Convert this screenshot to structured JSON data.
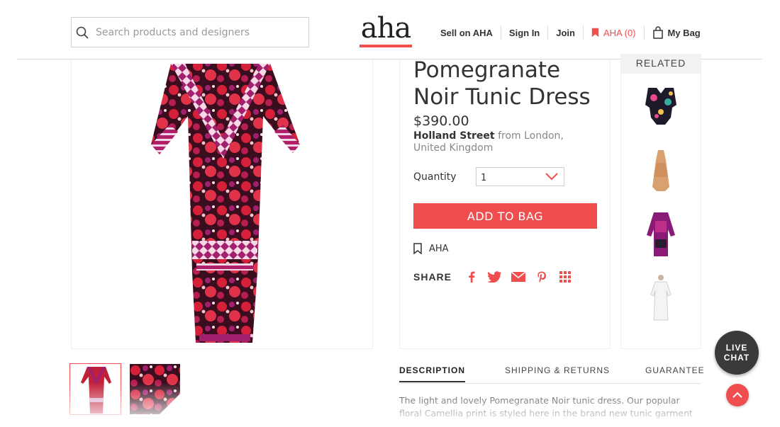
{
  "header": {
    "search_placeholder": "Search products and designers",
    "logo": "aha",
    "nav": {
      "sell": "Sell on AHA",
      "sign_in": "Sign In",
      "join": "Join",
      "saved": "AHA (0)",
      "bag": "My Bag"
    }
  },
  "product": {
    "title": "Pomegranate Noir Tunic Dress",
    "price": "$390.00",
    "designer": "Holland Street",
    "origin": "from London, United Kingdom",
    "quantity_label": "Quantity",
    "quantity_value": "1",
    "add_button": "ADD TO BAG",
    "save_label": "AHA",
    "share_label": "SHARE"
  },
  "related": {
    "heading": "RELATED",
    "items": [
      "swimsuit",
      "slip-dress",
      "purple-kaftan",
      "white-tunic"
    ]
  },
  "tabs": {
    "description": "DESCRIPTION",
    "shipping": "SHIPPING & RETURNS",
    "guarantee": "GUARANTEE"
  },
  "description_text": "The light and lovely Pomegranate Noir tunic dress. Our popular floral Camellia print is styled here in the brand new tunic garment",
  "live_chat": {
    "line1": "LIVE",
    "line2": "CHAT"
  },
  "colors": {
    "accent": "#f04e4e",
    "text": "#333333",
    "dress_red": "#c2203a",
    "dress_magenta": "#a0206e"
  }
}
